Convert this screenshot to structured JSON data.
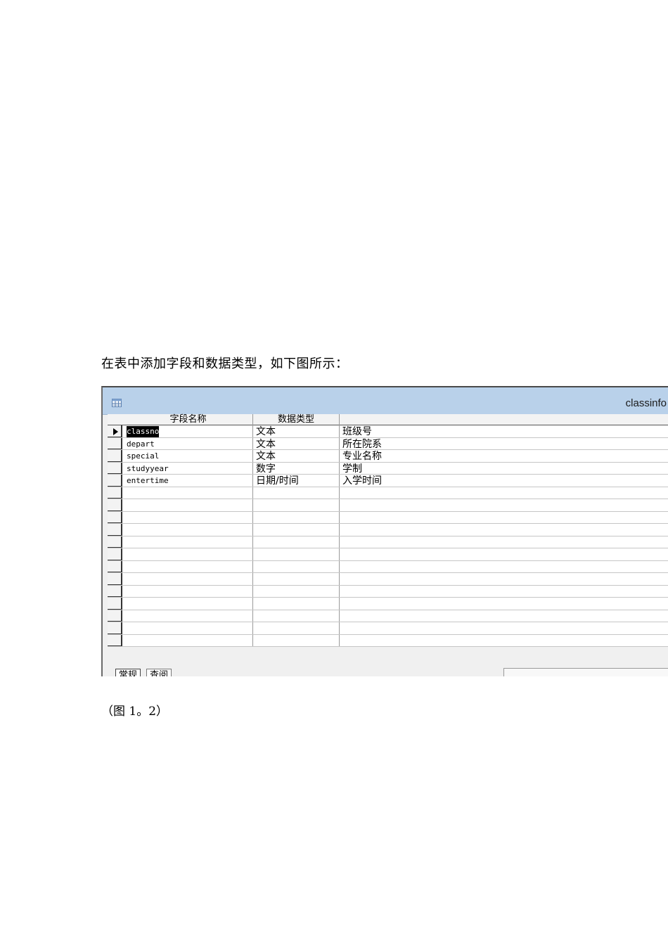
{
  "intro_text": "在表中添加字段和数据类型，如下图所示：",
  "caption": "（图 1。2）",
  "window": {
    "title": "classinfo",
    "icon": "table-icon"
  },
  "table": {
    "columns": [
      "字段名称",
      "数据类型",
      ""
    ],
    "rows": [
      {
        "name": "classno",
        "type": "文本",
        "desc": "班级号"
      },
      {
        "name": "depart",
        "type": "文本",
        "desc": "所在院系"
      },
      {
        "name": "special",
        "type": "文本",
        "desc": "专业名称"
      },
      {
        "name": "studyyear",
        "type": "数字",
        "desc": "学制"
      },
      {
        "name": "entertime",
        "type": "日期/时间",
        "desc": "入学时间"
      }
    ],
    "empty_rows": 13
  },
  "tabs": [
    "常规",
    "查阅"
  ],
  "colors": {
    "titlebar": "#b9d1ea",
    "selection": "#000000"
  }
}
